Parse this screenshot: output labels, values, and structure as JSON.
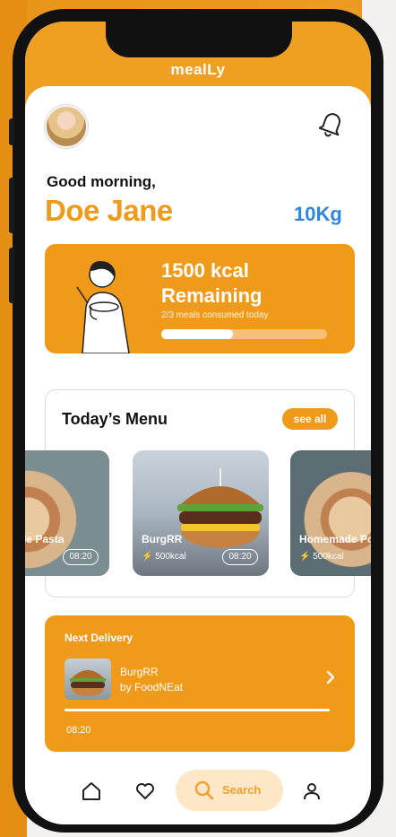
{
  "app": {
    "brand": "mealLy"
  },
  "user": {
    "greeting": "Good morning,",
    "name": "Doe Jane",
    "weight": "10Kg"
  },
  "calories": {
    "title_line1": "1500 kcal",
    "title_line2": "Remaining",
    "subtitle": "2/3 meals consumed today",
    "progress_fraction": 0.43
  },
  "menu": {
    "title": "Today’s Menu",
    "see_all_label": "see all",
    "items": [
      {
        "name": "omemade Pasta",
        "kcal": "",
        "time": "08:20"
      },
      {
        "name": "BurgRR",
        "kcal": "500kcal",
        "time": "08:20"
      },
      {
        "name": "Homemade Po",
        "kcal": "500kcal",
        "time": ""
      }
    ]
  },
  "delivery": {
    "label": "Next Delivery",
    "item_name": "BurgRR",
    "vendor": "by FoodNEat",
    "time": "08:20"
  },
  "navbar": {
    "search_label": "Search"
  },
  "colors": {
    "accent": "#f09a1a",
    "weight_blue": "#2e86de",
    "search_pill": "#fde7c6"
  }
}
